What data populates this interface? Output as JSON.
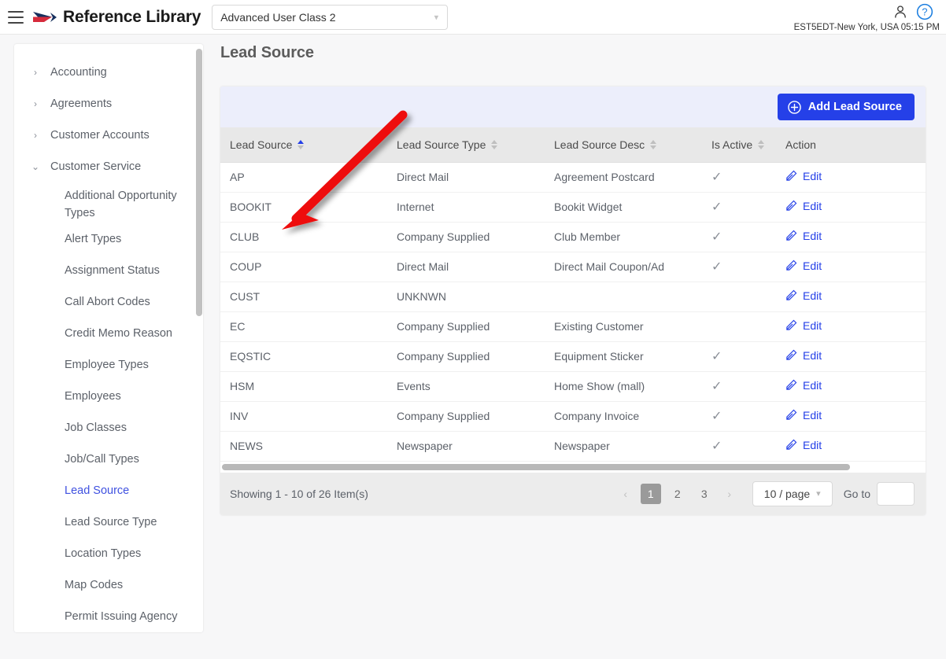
{
  "topbar": {
    "menu_icon": "hamburger-icon",
    "logo_icon": "brand-arrow-logo",
    "brand_title": "Reference Library",
    "user_class_select": {
      "value": "Advanced User Class 2",
      "caret_icon": "chevron-down-icon"
    },
    "user_icon": "user-account-icon",
    "help_icon": "help-question-icon",
    "timezone_text": "EST5EDT-New York, USA 05:15 PM"
  },
  "sidebar": {
    "groups": [
      {
        "label": "Accounting",
        "expanded": false,
        "icon": "chevron-right-icon"
      },
      {
        "label": "Agreements",
        "expanded": false,
        "icon": "chevron-right-icon"
      },
      {
        "label": "Customer Accounts",
        "expanded": false,
        "icon": "chevron-right-icon"
      },
      {
        "label": "Customer Service",
        "expanded": true,
        "icon": "chevron-down-icon"
      }
    ],
    "items": [
      {
        "label": "Additional Opportunity Types",
        "active": false
      },
      {
        "label": "Alert Types",
        "active": false
      },
      {
        "label": "Assignment Status",
        "active": false
      },
      {
        "label": "Call Abort Codes",
        "active": false
      },
      {
        "label": "Credit Memo Reason",
        "active": false
      },
      {
        "label": "Employee Types",
        "active": false
      },
      {
        "label": "Employees",
        "active": false
      },
      {
        "label": "Job Classes",
        "active": false
      },
      {
        "label": "Job/Call Types",
        "active": false
      },
      {
        "label": "Lead Source",
        "active": true
      },
      {
        "label": "Lead Source Type",
        "active": false
      },
      {
        "label": "Location Types",
        "active": false
      },
      {
        "label": "Map Codes",
        "active": false
      },
      {
        "label": "Permit Issuing Agency",
        "active": false
      }
    ]
  },
  "main": {
    "page_title": "Lead Source",
    "toolbar": {
      "add_button_label": "Add Lead Source",
      "add_button_icon": "plus-circle-icon",
      "add_button_color": "#2540e8",
      "background_color": "#eceefb"
    },
    "table": {
      "columns": [
        {
          "label": "Lead Source",
          "sortable": true,
          "sort_state": "asc"
        },
        {
          "label": "Lead Source Type",
          "sortable": true,
          "sort_state": "none"
        },
        {
          "label": "Lead Source Desc",
          "sortable": true,
          "sort_state": "none"
        },
        {
          "label": "Is Active",
          "sortable": true,
          "sort_state": "none"
        },
        {
          "label": "Action",
          "sortable": false,
          "sort_state": "none"
        }
      ],
      "rows": [
        {
          "lead_source": "AP",
          "lead_source_type": "Direct Mail",
          "lead_source_desc": "Agreement Postcard",
          "is_active": "✓",
          "action_label": "Edit",
          "action_icon": "pencil-edit-icon"
        },
        {
          "lead_source": "BOOKIT",
          "lead_source_type": "Internet",
          "lead_source_desc": "Bookit Widget",
          "is_active": "✓",
          "action_label": "Edit",
          "action_icon": "pencil-edit-icon"
        },
        {
          "lead_source": "CLUB",
          "lead_source_type": "Company Supplied",
          "lead_source_desc": "Club Member",
          "is_active": "✓",
          "action_label": "Edit",
          "action_icon": "pencil-edit-icon"
        },
        {
          "lead_source": "COUP",
          "lead_source_type": "Direct Mail",
          "lead_source_desc": "Direct Mail Coupon/Ad",
          "is_active": "✓",
          "action_label": "Edit",
          "action_icon": "pencil-edit-icon"
        },
        {
          "lead_source": "CUST",
          "lead_source_type": "UNKNWN",
          "lead_source_desc": "",
          "is_active": "",
          "action_label": "Edit",
          "action_icon": "pencil-edit-icon"
        },
        {
          "lead_source": "EC",
          "lead_source_type": "Company Supplied",
          "lead_source_desc": "Existing Customer",
          "is_active": "",
          "action_label": "Edit",
          "action_icon": "pencil-edit-icon"
        },
        {
          "lead_source": "EQSTIC",
          "lead_source_type": "Company Supplied",
          "lead_source_desc": "Equipment Sticker",
          "is_active": "✓",
          "action_label": "Edit",
          "action_icon": "pencil-edit-icon"
        },
        {
          "lead_source": "HSM",
          "lead_source_type": "Events",
          "lead_source_desc": "Home Show (mall)",
          "is_active": "✓",
          "action_label": "Edit",
          "action_icon": "pencil-edit-icon"
        },
        {
          "lead_source": "INV",
          "lead_source_type": "Company Supplied",
          "lead_source_desc": "Company Invoice",
          "is_active": "✓",
          "action_label": "Edit",
          "action_icon": "pencil-edit-icon"
        },
        {
          "lead_source": "NEWS",
          "lead_source_type": "Newspaper",
          "lead_source_desc": "Newspaper",
          "is_active": "✓",
          "action_label": "Edit",
          "action_icon": "pencil-edit-icon"
        }
      ]
    },
    "footer": {
      "showing_text": "Showing 1 - 10 of 26 Item(s)",
      "prev_icon": "chevron-left-icon",
      "next_icon": "chevron-right-icon",
      "pages": [
        "1",
        "2",
        "3"
      ],
      "active_page": "1",
      "page_size_label": "10 / page",
      "page_size_caret": "chevron-down-icon",
      "goto_label": "Go to",
      "goto_value": "",
      "goto_placeholder": ""
    }
  },
  "annotation": {
    "type": "red-arrow",
    "color": "#ee1111",
    "points_to": "BOOKIT row lead source cell"
  }
}
